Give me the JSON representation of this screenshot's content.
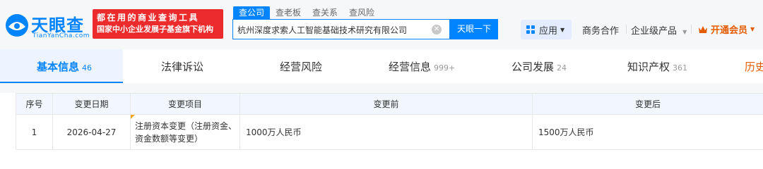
{
  "header": {
    "logo_text": "天眼查",
    "logo_domain": "TianYanCha.com",
    "slogan_line1": "都在用的商业查询工具",
    "slogan_line2": "国家中小企业发展子基金旗下机构",
    "search_tabs": [
      {
        "label": "查公司",
        "active": true
      },
      {
        "label": "查老板",
        "active": false
      },
      {
        "label": "查关系",
        "active": false
      },
      {
        "label": "查风险",
        "active": false
      }
    ],
    "search_value": "杭州深度求索人工智能基础技术研究有限公司",
    "search_button": "天眼一下",
    "app_label": "应用",
    "nav": [
      "商务合作",
      "企业级产品"
    ],
    "vip_label": "开通会员"
  },
  "tabs": [
    {
      "label": "基本信息",
      "count": "46",
      "active": true
    },
    {
      "label": "法律诉讼",
      "count": "",
      "active": false
    },
    {
      "label": "经营风险",
      "count": "",
      "active": false
    },
    {
      "label": "经营信息",
      "count": "999+",
      "active": false
    },
    {
      "label": "公司发展",
      "count": "24",
      "active": false
    },
    {
      "label": "知识产权",
      "count": "361",
      "active": false
    },
    {
      "label": "历史",
      "count": "",
      "active": false
    }
  ],
  "table": {
    "headers": [
      "序号",
      "变更日期",
      "变更项目",
      "变更前",
      "变更后"
    ],
    "rows": [
      {
        "seq": "1",
        "date": "2026-04-27",
        "item": "注册资本变更（注册资金、资金数额等变更）",
        "before": "1000万人民币",
        "after": "1500万人民币"
      }
    ]
  },
  "colors": {
    "brand": "#0084ff",
    "slogan_bg": "#ec2c2c",
    "vip": "#e55c00"
  }
}
